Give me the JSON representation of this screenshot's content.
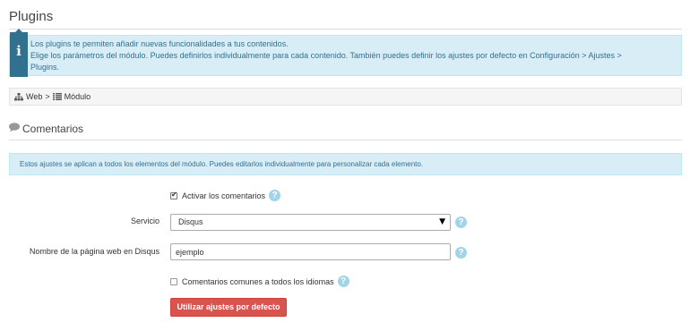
{
  "page": {
    "title": "Plugins"
  },
  "info_box": {
    "icon": "info-icon",
    "line1": "Los plugins te permiten añadir nuevas funcionalidades a tus contenidos.",
    "line2": "Elige los parámetros del módulo. Puedes definirlos individualmente para cada contenido. También puedes definir los ajustes por defecto en Configuración > Ajustes >",
    "line3": "Plugins."
  },
  "breadcrumb": {
    "items": [
      {
        "label": "Web",
        "icon": "sitemap-icon"
      },
      {
        "label": "Módulo",
        "icon": "list-icon"
      }
    ],
    "separator": ">"
  },
  "section": {
    "title": "Comentarios",
    "icon": "comment-icon"
  },
  "scope_note": {
    "text": "Estos ajustes se aplican a todos los elementos del módulo. Puedes editarlos individualmente para personalizar cada elemento."
  },
  "form": {
    "enable_comments": {
      "label": "Activar los comentarios",
      "checked": true
    },
    "service": {
      "label": "Servicio",
      "value": "Disqus"
    },
    "site_name": {
      "label": "Nombre de la página web en Disqus",
      "value": "ejemplo"
    },
    "shared_comments": {
      "label": "Comentarios comunes a todos los idiomas",
      "checked": false
    },
    "help_glyph": "?",
    "default_button_label": "Utilizar ajustes por defecto"
  },
  "colors": {
    "info_bg": "#d9edf7",
    "info_text": "#31708f",
    "danger": "#d9534f",
    "help": "#9fd4e9"
  }
}
